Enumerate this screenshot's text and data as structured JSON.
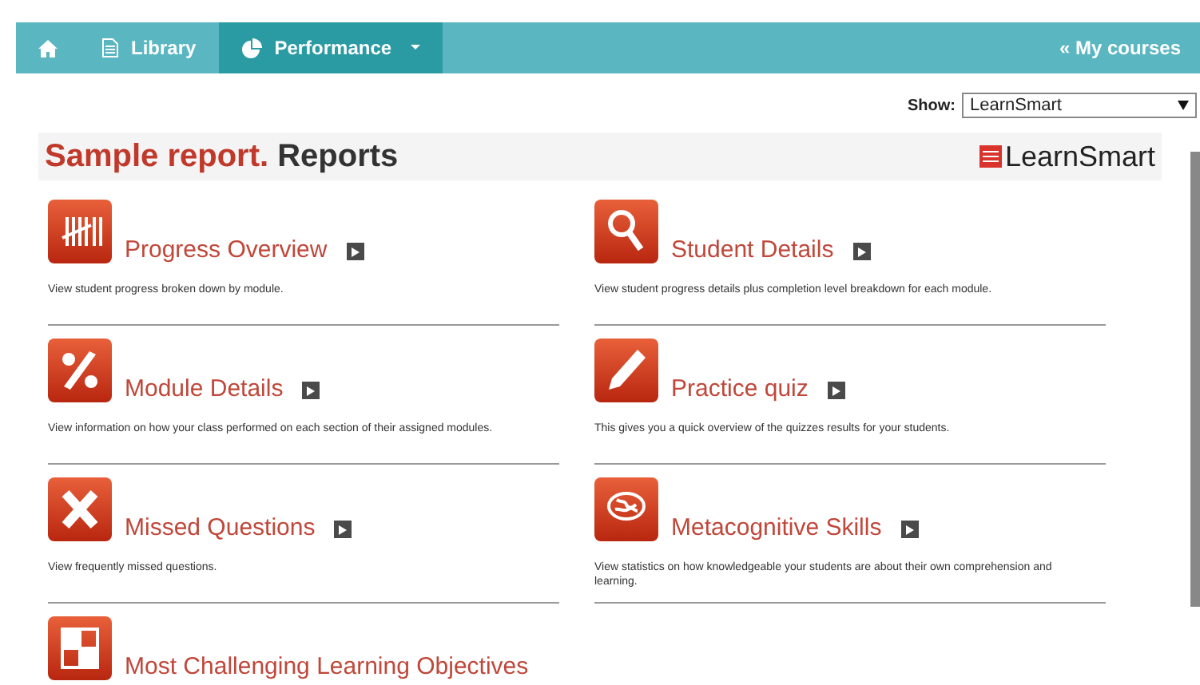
{
  "nav": {
    "items": [
      {
        "kind": "home",
        "selected": false
      },
      {
        "kind": "library",
        "label": "Library",
        "selected": false
      },
      {
        "kind": "performance",
        "label": "Performance",
        "selected": true
      }
    ],
    "right_link": "« My courses"
  },
  "show": {
    "label": "Show:",
    "value": "LearnSmart"
  },
  "header": {
    "title_accent": "Sample report.",
    "title": "Reports",
    "logo": "LearnSmart"
  },
  "reports": [
    {
      "title": "Progress Overview",
      "play_button": true,
      "description": "View student progress broken down by module."
    },
    {
      "title": "Student Details",
      "play_button": true,
      "description": "View student progress details plus completion level breakdown for each module."
    },
    {
      "title": "Module Details",
      "play_button": true,
      "description": "View information on how your class performed on each section of their assigned modules."
    },
    {
      "title": "Practice quiz",
      "play_button": true,
      "description": "This gives you a quick overview of the quizzes results for your students."
    },
    {
      "title": "Missed Questions",
      "play_button": true,
      "description": "View frequently missed questions."
    },
    {
      "title": "Metacognitive Skills",
      "play_button": true,
      "description": "View statistics on how knowledgeable your students are about their own comprehension and learning."
    },
    {
      "title": "Most Challenging Learning Objectives",
      "play_button": false
    }
  ]
}
